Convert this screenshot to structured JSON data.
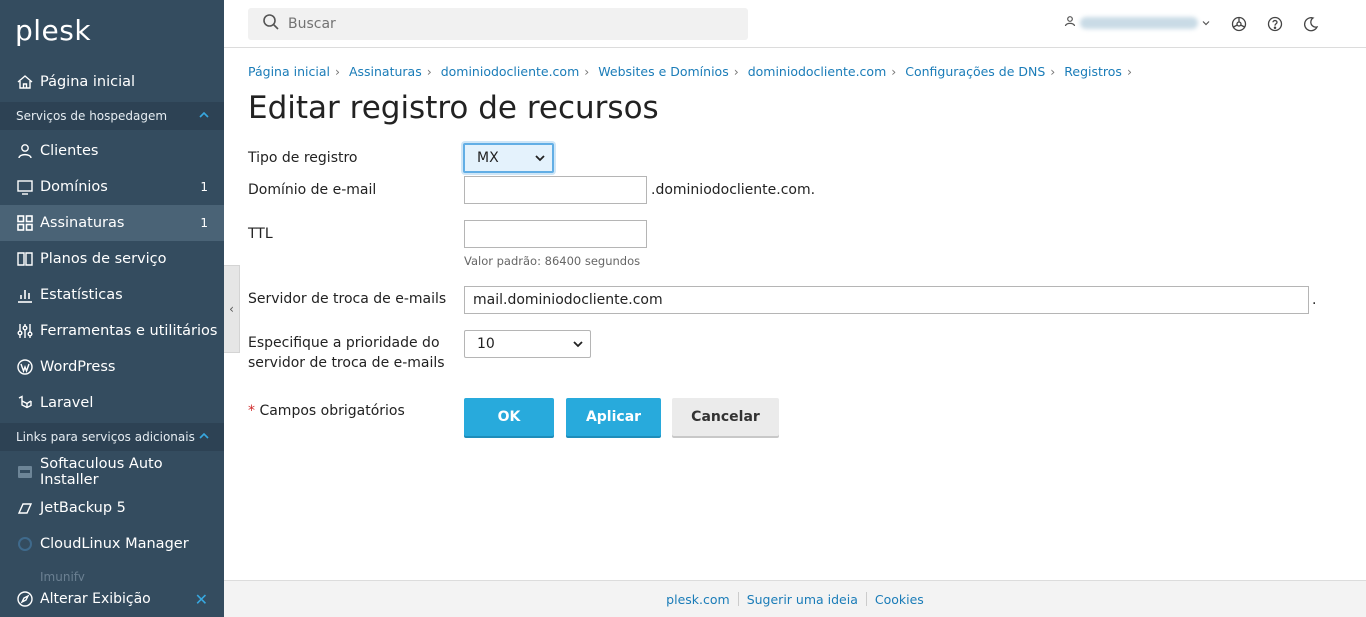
{
  "brand": "plesk",
  "sidebar": {
    "home": "Página inicial",
    "section_hosting": "Serviços de hospedagem",
    "items": [
      {
        "label": "Clientes",
        "count": ""
      },
      {
        "label": "Domínios",
        "count": "1"
      },
      {
        "label": "Assinaturas",
        "count": "1"
      },
      {
        "label": "Planos de serviço",
        "count": ""
      },
      {
        "label": "Estatísticas",
        "count": ""
      },
      {
        "label": "Ferramentas e utilitários",
        "count": ""
      },
      {
        "label": "WordPress",
        "count": ""
      },
      {
        "label": "Laravel",
        "count": ""
      }
    ],
    "section_links": "Links para serviços adicionais",
    "links": [
      {
        "label": "Softaculous Auto Installer"
      },
      {
        "label": "JetBackup 5"
      },
      {
        "label": "CloudLinux Manager"
      }
    ],
    "faded_item": "Imunify",
    "change_view": "Alterar Exibição"
  },
  "header": {
    "search_placeholder": "Buscar"
  },
  "breadcrumb": [
    "Página inicial",
    "Assinaturas",
    "dominiodocliente.com",
    "Websites e Domínios",
    "dominiodocliente.com",
    "Configurações de DNS",
    "Registros"
  ],
  "page_title": "Editar registro de recursos",
  "form": {
    "record_type_label": "Tipo de registro",
    "record_type_value": "MX",
    "email_domain_label": "Domínio de e-mail",
    "email_domain_value": "",
    "email_domain_suffix": ".dominiodocliente.com.",
    "ttl_label": "TTL",
    "ttl_value": "",
    "ttl_hint": "Valor padrão: 86400 segundos",
    "mail_server_label": "Servidor de troca de e-mails",
    "mail_server_value": "mail.dominiodocliente.com",
    "mail_server_suffix": ".",
    "priority_label_line1": "Especifique a prioridade do",
    "priority_label_line2": "servidor de troca de e-mails",
    "priority_value": "10",
    "required_star": "*",
    "required_note": "Campos obrigatórios",
    "ok": "OK",
    "apply": "Aplicar",
    "cancel": "Cancelar"
  },
  "footer": {
    "links": [
      "plesk.com",
      "Sugerir uma ideia",
      "Cookies"
    ]
  },
  "colors": {
    "sidebar_bg": "#344c5f",
    "accent": "#28aadc",
    "link": "#1a7cb8"
  }
}
